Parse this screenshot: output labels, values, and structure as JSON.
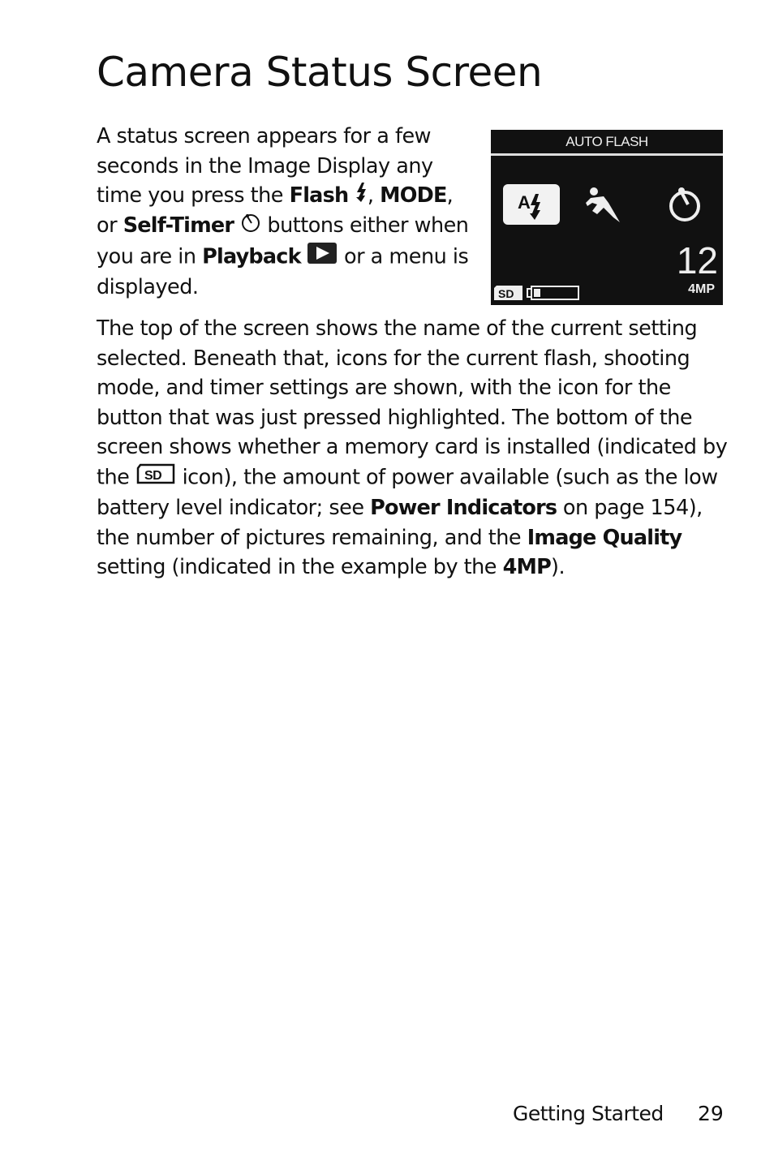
{
  "page": {
    "title": "Camera Status Screen",
    "footer_section": "Getting Started",
    "page_number": "29"
  },
  "para1": {
    "t1": "A status screen appears for a few seconds in the Image Display any time you press the ",
    "flash": "Flash",
    "t2": ", ",
    "mode": "MODE",
    "t3": ", or ",
    "self_timer": "Self-Timer",
    "t4": " buttons either when you are in ",
    "playback": "Playback",
    "t5": " or a menu is displayed."
  },
  "para2": {
    "t1": "The top of the screen shows the name of the current setting selected. Beneath that, icons for the current flash, shooting mode, and timer settings are shown, with the icon for the button that was just pressed highlighted. The bottom of the screen shows whether a memory card is installed (indicated by the ",
    "t2": " icon), the amount of power available (such as the low battery level indicator; see ",
    "power": "Power Indicators",
    "t3": " on page 154), the number of pictures remaining, and the ",
    "iq": "Image Quality",
    "t4": " setting (indicated in the example by the ",
    "mp": "4MP",
    "t5": ")."
  },
  "screen": {
    "header": "AUTO FLASH",
    "flash_letter": "A",
    "pictures_remaining": "12",
    "quality": "4MP",
    "sd_label": "SD",
    "icons": [
      "auto-flash-icon",
      "action-mode-icon",
      "self-timer-icon"
    ],
    "battery_level": "low"
  }
}
